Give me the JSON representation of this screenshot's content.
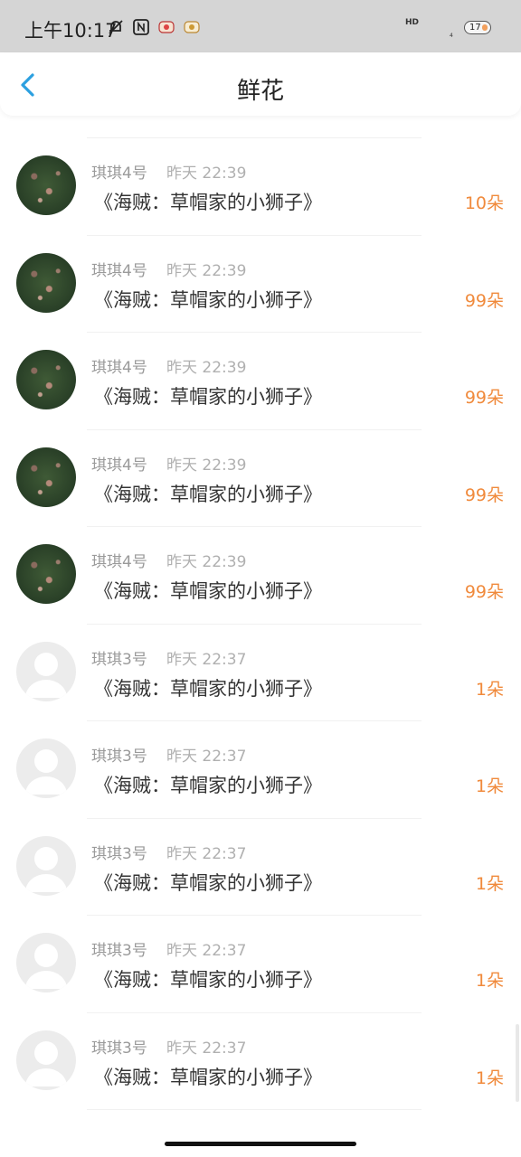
{
  "status_bar": {
    "time": "上午10:17",
    "hd": "HD",
    "signal": "4",
    "battery": "17"
  },
  "header": {
    "title": "鲜花"
  },
  "rows": [
    {
      "user": "琪琪4号",
      "time": "昨天 22:39",
      "title": "《海贼：草帽家的小狮子》",
      "count": "10朵",
      "avatar": "photo"
    },
    {
      "user": "琪琪4号",
      "time": "昨天 22:39",
      "title": "《海贼：草帽家的小狮子》",
      "count": "99朵",
      "avatar": "photo"
    },
    {
      "user": "琪琪4号",
      "time": "昨天 22:39",
      "title": "《海贼：草帽家的小狮子》",
      "count": "99朵",
      "avatar": "photo"
    },
    {
      "user": "琪琪4号",
      "time": "昨天 22:39",
      "title": "《海贼：草帽家的小狮子》",
      "count": "99朵",
      "avatar": "photo"
    },
    {
      "user": "琪琪4号",
      "time": "昨天 22:39",
      "title": "《海贼：草帽家的小狮子》",
      "count": "99朵",
      "avatar": "photo"
    },
    {
      "user": "琪琪3号",
      "time": "昨天 22:37",
      "title": "《海贼：草帽家的小狮子》",
      "count": "1朵",
      "avatar": "default"
    },
    {
      "user": "琪琪3号",
      "time": "昨天 22:37",
      "title": "《海贼：草帽家的小狮子》",
      "count": "1朵",
      "avatar": "default"
    },
    {
      "user": "琪琪3号",
      "time": "昨天 22:37",
      "title": "《海贼：草帽家的小狮子》",
      "count": "1朵",
      "avatar": "default"
    },
    {
      "user": "琪琪3号",
      "time": "昨天 22:37",
      "title": "《海贼：草帽家的小狮子》",
      "count": "1朵",
      "avatar": "default"
    },
    {
      "user": "琪琪3号",
      "time": "昨天 22:37",
      "title": "《海贼：草帽家的小狮子》",
      "count": "1朵",
      "avatar": "default"
    }
  ],
  "colors": {
    "accent_back": "#2ca0e0",
    "flower_count": "#f08a3c",
    "status_bar_bg": "#d5d5d5"
  },
  "icons": {
    "back": "chevron-left-icon",
    "mute": "bell-off-icon",
    "nfc": "nfc-icon"
  }
}
